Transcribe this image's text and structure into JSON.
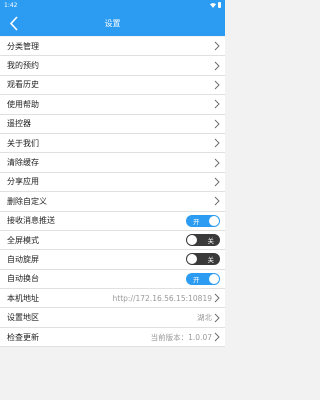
{
  "status_bar": {
    "time": "1:42"
  },
  "header": {
    "title": "设置",
    "back_icon": "chevron-left-icon"
  },
  "colors": {
    "accent": "#2b9cf2",
    "toggle_off": "#3a3a3a"
  },
  "items": [
    {
      "label": "分类管理"
    },
    {
      "label": "我的预约"
    },
    {
      "label": "观看历史"
    },
    {
      "label": "使用帮助"
    },
    {
      "label": "遥控器"
    },
    {
      "label": "关于我们"
    },
    {
      "label": "清除缓存"
    },
    {
      "label": "分享应用"
    },
    {
      "label": "删除自定义"
    }
  ],
  "toggles": [
    {
      "label": "接收消息推送",
      "state": "开",
      "on": true
    },
    {
      "label": "全屏模式",
      "state": "关",
      "on": false
    },
    {
      "label": "自动旋屏",
      "state": "关",
      "on": false
    },
    {
      "label": "自动换台",
      "state": "开",
      "on": true
    }
  ],
  "info": [
    {
      "label": "本机地址",
      "value": "http://172.16.56.15:10819"
    },
    {
      "label": "设置地区",
      "value": "湖北"
    },
    {
      "label": "检查更新",
      "value": "当前版本：1.0.07"
    }
  ]
}
